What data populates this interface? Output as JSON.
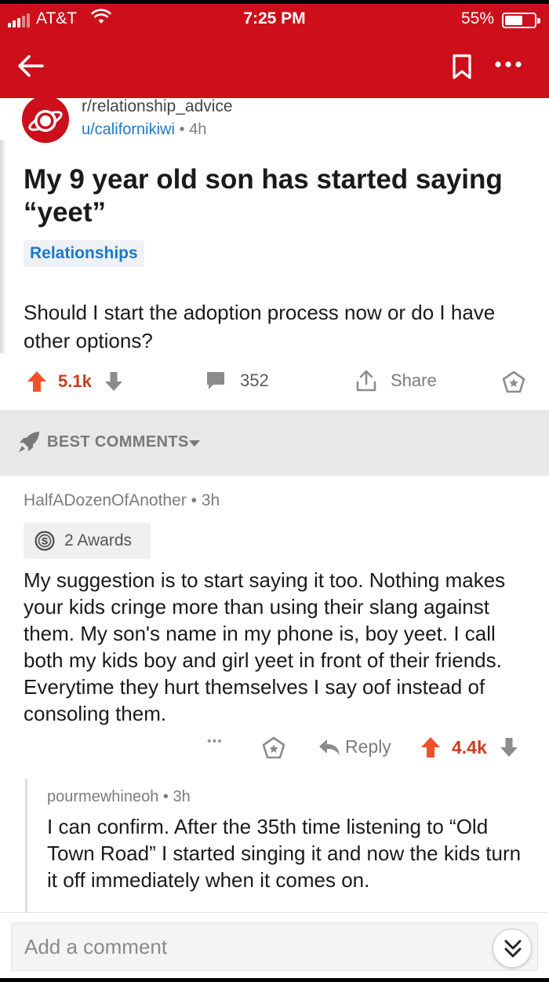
{
  "status": {
    "carrier": "AT&T",
    "time": "7:25 PM",
    "battery": "55%"
  },
  "colors": {
    "brand_red": "#cc0f1a",
    "link_blue": "#1d78c8",
    "upvote_orange": "#f0502a"
  },
  "header": {
    "back_icon": "arrow-left-icon",
    "save_icon": "bookmark-icon",
    "more_icon": "more-dots-icon"
  },
  "post": {
    "subreddit": "r/relationship_advice",
    "author": "u/californikiwi",
    "separator": "•",
    "age": "4h",
    "title": "My 9 year old son has started saying “yeet”",
    "flair": "Relationships",
    "body": "Should I start the adoption process now or do I have other options?",
    "score": "5.1k",
    "comments": "352",
    "share_label": "Share"
  },
  "sort": {
    "label": "BEST COMMENTS"
  },
  "comment": {
    "author": "HalfADozenOfAnother",
    "separator": "•",
    "age": "3h",
    "awards": "2 Awards",
    "body": "My suggestion is to start saying it too.  Nothing makes your kids cringe more than using their slang against them.  My son's name in my phone is, boy yeet.  I call both my kids boy and girl yeet in front of their friends.  Everytime they hurt themselves I say oof instead of consoling them.",
    "more": "•••",
    "reply_label": "Reply",
    "score": "4.4k"
  },
  "reply": {
    "author": "pourmewhineoh",
    "separator": "•",
    "age": "3h",
    "body": "I can confirm. After the 35th time listening to “Old Town Road” I started singing it and now the kids turn it off immediately when it comes on."
  },
  "composer": {
    "placeholder": "Add a comment"
  }
}
